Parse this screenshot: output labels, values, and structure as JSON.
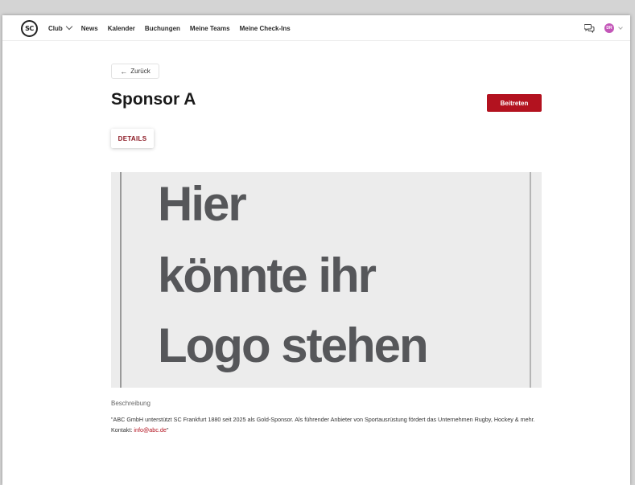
{
  "nav": {
    "logo_text": "SC",
    "items": [
      {
        "label": "Club",
        "has_dropdown": true
      },
      {
        "label": "News"
      },
      {
        "label": "Kalender"
      },
      {
        "label": "Buchungen"
      },
      {
        "label": "Meine Teams"
      },
      {
        "label": "Meine Check-Ins"
      }
    ],
    "avatar_initials": "DR",
    "avatar_color": "#c356b8",
    "chat_icon": "chat-bubbles-icon"
  },
  "page": {
    "back_label": "Zurück",
    "title": "Sponsor A",
    "join_label": "Beitreten",
    "tab_label": "DETAILS",
    "accent_color": "#b3121f"
  },
  "image": {
    "lines": [
      "Hier",
      "könnte ihr",
      "Logo stehen"
    ]
  },
  "description": {
    "label": "Beschreibung",
    "text": "\"ABC GmbH unterstützt SC Frankfurt 1880 seit 2025 als Gold-Sponsor. Als führender Anbieter von Sportausrüstung fördert das Unternehmen Rugby, Hockey & mehr. Kontakt: ",
    "link": "info@abc.de",
    "suffix": "\""
  }
}
